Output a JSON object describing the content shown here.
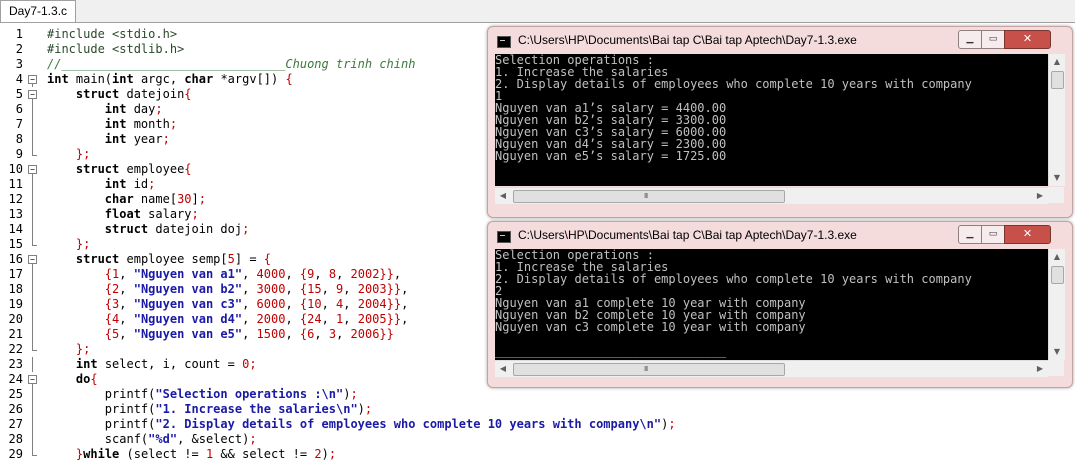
{
  "tab": {
    "label": "Day7-1.3.c"
  },
  "editor": {
    "lines": [
      {
        "n": "1",
        "fold": "",
        "html": "<span class='pp'>#include &lt;stdio.h&gt;</span>"
      },
      {
        "n": "2",
        "fold": "",
        "html": "<span class='pp'>#include &lt;stdlib.h&gt;</span>"
      },
      {
        "n": "3",
        "fold": "",
        "html": "<span class='com'>//_______________________________Chuong trinh chinh</span>"
      },
      {
        "n": "4",
        "fold": "open",
        "html": "<span class='kw'>int</span> main(<span class='kw'>int</span> argc, <span class='kw'>char</span> *argv[]) <span class='op'>{</span>"
      },
      {
        "n": "5",
        "fold": "open",
        "html": "    <span class='kw'>struct</span> datejoin<span class='op'>{</span>"
      },
      {
        "n": "6",
        "fold": "line",
        "html": "        <span class='kw'>int</span> day<span class='op'>;</span>"
      },
      {
        "n": "7",
        "fold": "line",
        "html": "        <span class='kw'>int</span> month<span class='op'>;</span>"
      },
      {
        "n": "8",
        "fold": "line",
        "html": "        <span class='kw'>int</span> year<span class='op'>;</span>"
      },
      {
        "n": "9",
        "fold": "end",
        "html": "    <span class='op'>};</span>"
      },
      {
        "n": "10",
        "fold": "open",
        "html": "    <span class='kw'>struct</span> employee<span class='op'>{</span>"
      },
      {
        "n": "11",
        "fold": "line",
        "html": "        <span class='kw'>int</span> id<span class='op'>;</span>"
      },
      {
        "n": "12",
        "fold": "line",
        "html": "        <span class='kw'>char</span> name[<span class='num'>30</span>]<span class='op'>;</span>"
      },
      {
        "n": "13",
        "fold": "line",
        "html": "        <span class='kw'>float</span> salary<span class='op'>;</span>"
      },
      {
        "n": "14",
        "fold": "line",
        "html": "        <span class='kw'>struct</span> datejoin doj<span class='op'>;</span>"
      },
      {
        "n": "15",
        "fold": "end",
        "html": "    <span class='op'>};</span>"
      },
      {
        "n": "16",
        "fold": "open",
        "html": "    <span class='kw'>struct</span> employee semp[<span class='num'>5</span>] = <span class='op'>{</span>"
      },
      {
        "n": "17",
        "fold": "line",
        "html": "        <span class='op'>{</span><span class='num'>1</span>, <span class='str'>\"Nguyen van a1\"</span>, <span class='num'>4000</span>, <span class='op'>{</span><span class='num'>9</span>, <span class='num'>8</span>, <span class='num'>2002</span><span class='op'>}}</span>,"
      },
      {
        "n": "18",
        "fold": "line",
        "html": "        <span class='op'>{</span><span class='num'>2</span>, <span class='str'>\"Nguyen van b2\"</span>, <span class='num'>3000</span>, <span class='op'>{</span><span class='num'>15</span>, <span class='num'>9</span>, <span class='num'>2003</span><span class='op'>}}</span>,"
      },
      {
        "n": "19",
        "fold": "line",
        "html": "        <span class='op'>{</span><span class='num'>3</span>, <span class='str'>\"Nguyen van c3\"</span>, <span class='num'>6000</span>, <span class='op'>{</span><span class='num'>10</span>, <span class='num'>4</span>, <span class='num'>2004</span><span class='op'>}}</span>,"
      },
      {
        "n": "20",
        "fold": "line",
        "html": "        <span class='op'>{</span><span class='num'>4</span>, <span class='str'>\"Nguyen van d4\"</span>, <span class='num'>2000</span>, <span class='op'>{</span><span class='num'>24</span>, <span class='num'>1</span>, <span class='num'>2005</span><span class='op'>}}</span>,"
      },
      {
        "n": "21",
        "fold": "line",
        "html": "        <span class='op'>{</span><span class='num'>5</span>, <span class='str'>\"Nguyen van e5\"</span>, <span class='num'>1500</span>, <span class='op'>{</span><span class='num'>6</span>, <span class='num'>3</span>, <span class='num'>2006</span><span class='op'>}}</span>"
      },
      {
        "n": "22",
        "fold": "end",
        "html": "    <span class='op'>};</span>"
      },
      {
        "n": "23",
        "fold": "line",
        "html": "    <span class='kw'>int</span> select, i, count = <span class='num'>0</span><span class='op'>;</span>"
      },
      {
        "n": "24",
        "fold": "open",
        "html": "    <span class='kw'>do</span><span class='op'>{</span>"
      },
      {
        "n": "25",
        "fold": "line",
        "html": "        printf(<span class='str'>\"Selection operations :\\n\"</span>)<span class='op'>;</span>"
      },
      {
        "n": "26",
        "fold": "line",
        "html": "        printf(<span class='str'>\"1. Increase the salaries\\n\"</span>)<span class='op'>;</span>"
      },
      {
        "n": "27",
        "fold": "line",
        "html": "        printf(<span class='str'>\"2. Display details of employees who complete 10 years with company\\n\"</span>)<span class='op'>;</span>"
      },
      {
        "n": "28",
        "fold": "line",
        "html": "        scanf(<span class='str'>\"%d\"</span>, &amp;select)<span class='op'>;</span>"
      },
      {
        "n": "29",
        "fold": "end",
        "html": "    <span class='op'>}</span><span class='kw'>while</span> (select != <span class='num'>1</span> &amp;&amp; select != <span class='num'>2</span>)<span class='op'>;</span>"
      }
    ]
  },
  "window1": {
    "title": "C:\\Users\\HP\\Documents\\Bai tap C\\Bai tap Aptech\\Day7-1.3.exe",
    "output": [
      "Selection operations :",
      "1. Increase the salaries",
      "2. Display details of employees who complete 10 years with company",
      "1",
      "Nguyen van a1’s salary = 4400.00",
      "Nguyen van b2’s salary = 3300.00",
      "Nguyen van c3’s salary = 6000.00",
      "Nguyen van d4’s salary = 2300.00",
      "Nguyen van e5’s salary = 1725.00",
      "",
      "________________________________"
    ]
  },
  "window2": {
    "title": "C:\\Users\\HP\\Documents\\Bai tap C\\Bai tap Aptech\\Day7-1.3.exe",
    "output": [
      "Selection operations :",
      "1. Increase the salaries",
      "2. Display details of employees who complete 10 years with company",
      "2",
      "Nguyen van a1 complete 10 year with company",
      "Nguyen van b2 complete 10 year with company",
      "Nguyen van c3 complete 10 year with company",
      "",
      "________________________________"
    ]
  },
  "controls": {
    "minimize": "▁",
    "maximize": "▭",
    "close": "✕",
    "up": "▲",
    "down": "▼",
    "left": "◀",
    "right": "▶",
    "grip": "III"
  }
}
